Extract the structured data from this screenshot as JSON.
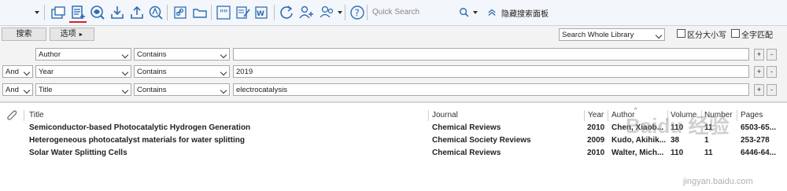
{
  "toolbar": {
    "quick_search_placeholder": "Quick Search",
    "hide_panel_label": "隐藏搜索面板"
  },
  "panel": {
    "search_button": "搜索",
    "options_button": "选项",
    "options_arrow": "►",
    "scope_select": "Search Whole Library",
    "match_case_label": "区分大小写",
    "match_words_label": "全字匹配",
    "rows": [
      {
        "bool": "",
        "field": "Author",
        "op": "Contains",
        "value": ""
      },
      {
        "bool": "And",
        "field": "Year",
        "op": "Contains",
        "value": "2019"
      },
      {
        "bool": "And",
        "field": "Title",
        "op": "Contains",
        "value": "electrocatalysis"
      }
    ],
    "plus": "+",
    "minus": "-"
  },
  "table": {
    "headers": {
      "title": "Title",
      "journal": "Journal",
      "year": "Year",
      "author": "Author",
      "volume": "Volume",
      "number": "Number",
      "pages": "Pages"
    },
    "rows": [
      {
        "title": "Semiconductor-based Photocatalytic Hydrogen Generation",
        "journal": "Chemical Reviews",
        "year": "2010",
        "author": "Chen, Xiaob...",
        "volume": "110",
        "number": "11",
        "pages": "6503-65..."
      },
      {
        "title": "Heterogeneous photocatalyst materials for water splitting",
        "journal": "Chemical Society Reviews",
        "year": "2009",
        "author": "Kudo, Akihik...",
        "volume": "38",
        "number": "1",
        "pages": "253-278"
      },
      {
        "title": "Solar Water Splitting Cells",
        "journal": "Chemical Reviews",
        "year": "2010",
        "author": "Walter, Mich...",
        "volume": "110",
        "number": "11",
        "pages": "6446-64..."
      }
    ]
  },
  "watermark": {
    "text": "Baidu 经验",
    "url": "jingyan.baidu.com"
  },
  "colors": {
    "icon_blue": "#2f6db5",
    "underline_red": "#e02020",
    "toolbar_bg": "#f3f6fa"
  }
}
